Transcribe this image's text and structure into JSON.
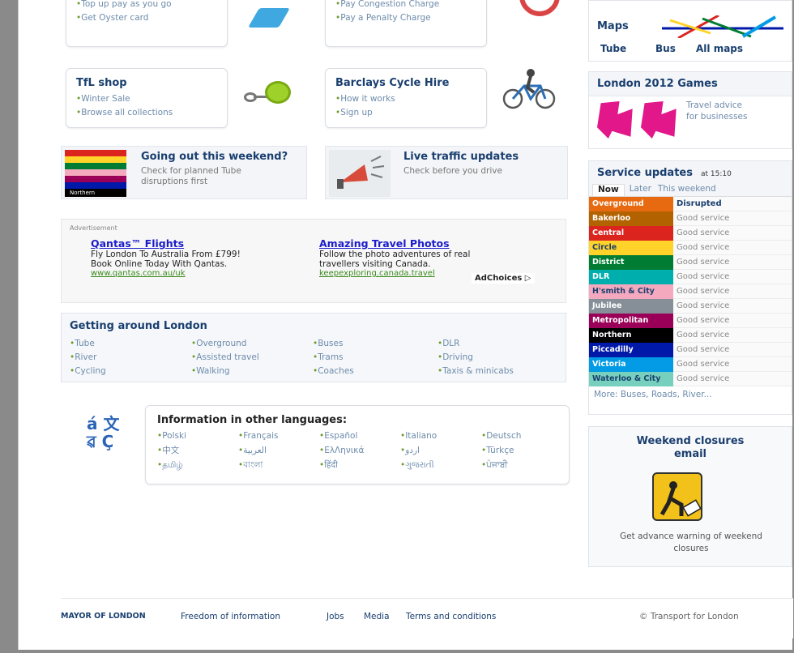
{
  "top_promos": {
    "oyster": {
      "link_partial": "Top up pay as you go",
      "link": "Get Oyster card"
    },
    "penalty": {
      "link_partial": "Pay Congestion Charge",
      "link": "Pay a Penalty Charge"
    }
  },
  "maps": {
    "title": "Maps",
    "tube": "Tube",
    "bus": "Bus",
    "all": "All maps"
  },
  "tfl_shop": {
    "title": "TfL shop",
    "items": [
      "Winter Sale",
      "Browse all collections"
    ]
  },
  "cycle_hire": {
    "title": "Barclays Cycle Hire",
    "items": [
      "How it works",
      "Sign up"
    ]
  },
  "games": {
    "title": "London 2012 Games",
    "text": "Travel advice for businesses"
  },
  "going_out": {
    "title": "Going out this weekend?",
    "text": "Check for planned Tube disruptions first",
    "img_caption": "Northern"
  },
  "traffic": {
    "title": "Live traffic updates",
    "text": "Check before you drive"
  },
  "advert": {
    "label": "Advertisement",
    "ad1": {
      "title": "Qantas™ Flights",
      "line1": "Fly London To Australia From £799!",
      "line2": "Book Online Today With Qantas.",
      "url": "www.qantas.com.au/uk"
    },
    "ad2": {
      "title": "Amazing Travel Photos",
      "line1": "Follow the photo adventures of real",
      "line2": "travellers visiting Canada.",
      "url": "keepexploring.canada.travel"
    },
    "adchoices": "AdChoices ▷"
  },
  "getting_around": {
    "title": "Getting around London",
    "links": [
      "Tube",
      "Overground",
      "Buses",
      "DLR",
      "River",
      "Assisted travel",
      "Trams",
      "Driving",
      "Cycling",
      "Walking",
      "Coaches",
      "Taxis & minicabs"
    ]
  },
  "languages": {
    "title": "Information in other languages:",
    "icon_top": "á 文",
    "icon_bottom": "ৱ Ç",
    "links": [
      "Polski",
      "Français",
      "Español",
      "Italiano",
      "Deutsch",
      "中文",
      "العربية",
      "EλΛηνικά",
      "اردو",
      "Türkçe",
      "தமிழ்",
      "বাংলা",
      "हिंदी",
      "ગુજરાતી",
      "ਪੰਜਾਬੀ"
    ]
  },
  "service_updates": {
    "title": "Service updates",
    "time": "at 15:10",
    "tabs": [
      "Now",
      "Later",
      "This weekend"
    ],
    "lines": [
      {
        "name": "Overground",
        "status": "Disrupted",
        "color": "#e86a10"
      },
      {
        "name": "Bakerloo",
        "status": "Good service",
        "color": "#b26300"
      },
      {
        "name": "Central",
        "status": "Good service",
        "color": "#dc241f"
      },
      {
        "name": "Circle",
        "status": "Good service",
        "color": "#ffd329"
      },
      {
        "name": "District",
        "status": "Good service",
        "color": "#007d32"
      },
      {
        "name": "DLR",
        "status": "Good service",
        "color": "#00afad"
      },
      {
        "name": "H'smith & City",
        "status": "Good service",
        "color": "#f4a9be"
      },
      {
        "name": "Jubilee",
        "status": "Good service",
        "color": "#868f98"
      },
      {
        "name": "Metropolitan",
        "status": "Good service",
        "color": "#9b0058"
      },
      {
        "name": "Northern",
        "status": "Good service",
        "color": "#000000"
      },
      {
        "name": "Piccadilly",
        "status": "Good service",
        "color": "#0019a8"
      },
      {
        "name": "Victoria",
        "status": "Good service",
        "color": "#039be5"
      },
      {
        "name": "Waterloo & City",
        "status": "Good service",
        "color": "#76d0bd"
      }
    ],
    "more": "More: Buses, Roads, River..."
  },
  "weekend_closures": {
    "title": "Weekend closures email",
    "text": "Get advance warning of weekend closures"
  },
  "footer": {
    "mayor": "MAYOR OF LONDON",
    "links": [
      "Freedom of information",
      "Jobs",
      "Media",
      "Terms and conditions"
    ],
    "copyright": "© Transport for London"
  }
}
